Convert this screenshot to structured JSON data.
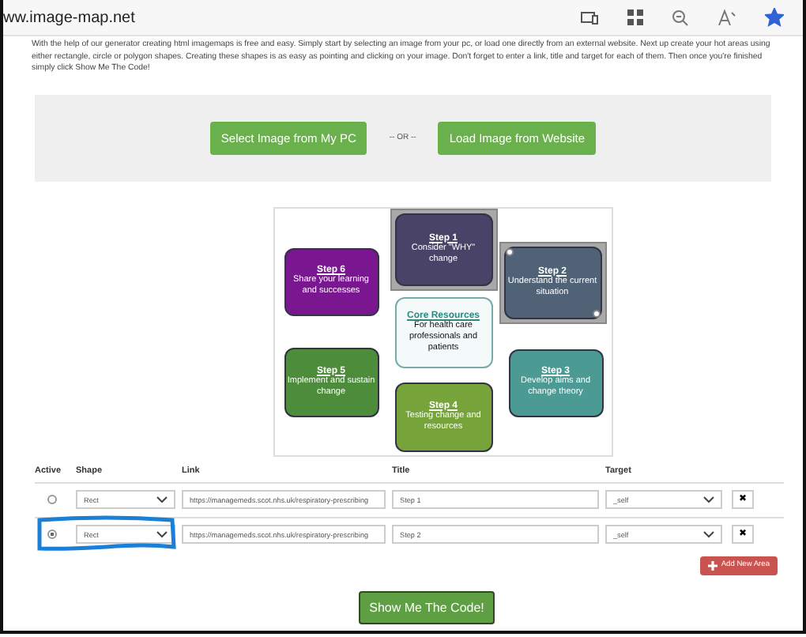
{
  "browser": {
    "url": "ww.image-map.net",
    "starred": true
  },
  "intro": "With the help of our generator creating html imagemaps is free and easy. Simply start by selecting an image from your pc, or load one directly from an external website. Next up create your hot areas using either rectangle, circle or polygon shapes. Creating these shapes is as easy as pointing and clicking on your image. Don't forget to enter a link, title and target for each of them. Then once you're finished simply click Show Me The Code!",
  "upload": {
    "buttons": [
      "Select Image from My PC",
      "Load Image from Website"
    ],
    "separator": "-- OR --"
  },
  "image": {
    "areas": [
      {
        "kind": "step",
        "heading": "Step 1",
        "text": "Consider \"WHY\" change",
        "color": "#4a4368",
        "overlay": true,
        "handles": false
      },
      {
        "kind": "step",
        "heading": "Step 6",
        "text": "Share your learning and successes",
        "color": "#7a168f",
        "overlay": false,
        "handles": false
      },
      {
        "kind": "step",
        "heading": "Step 2",
        "text": "Understand the current situation",
        "color": "#4f6276",
        "overlay": true,
        "handles": true
      },
      {
        "kind": "core",
        "heading": "Core Resources",
        "text": "For health care professionals and patients",
        "color": "#f4f9fa",
        "overlay": false,
        "handles": false
      },
      {
        "kind": "step",
        "heading": "Step 5",
        "text": "Implement and sustain change",
        "color": "#4d8c3a",
        "overlay": false,
        "handles": false
      },
      {
        "kind": "step",
        "heading": "Step 3",
        "text": "Develop aims and change theory",
        "color": "#4c9a94",
        "overlay": false,
        "handles": false
      },
      {
        "kind": "step",
        "heading": "Step 4",
        "text": "Testing change and resources",
        "color": "#76a33a",
        "overlay": false,
        "handles": false
      }
    ]
  },
  "table": {
    "columns": [
      "Active",
      "Shape",
      "Link",
      "Title",
      "Target"
    ],
    "rows": [
      {
        "selected": false,
        "shape": "Rect",
        "link": "https://managemeds.scot.nhs.uk/respiratory-prescribing",
        "title": "Step 1",
        "target": "_self",
        "delete": "✖",
        "circled": false
      },
      {
        "selected": true,
        "shape": "Rect",
        "link": "https://managemeds.scot.nhs.uk/respiratory-prescribing",
        "title": "Step 2",
        "target": "_self",
        "delete": "✖",
        "circled": true
      }
    ]
  },
  "add_button": "Add New Area",
  "code_button": "Show Me The Code!"
}
